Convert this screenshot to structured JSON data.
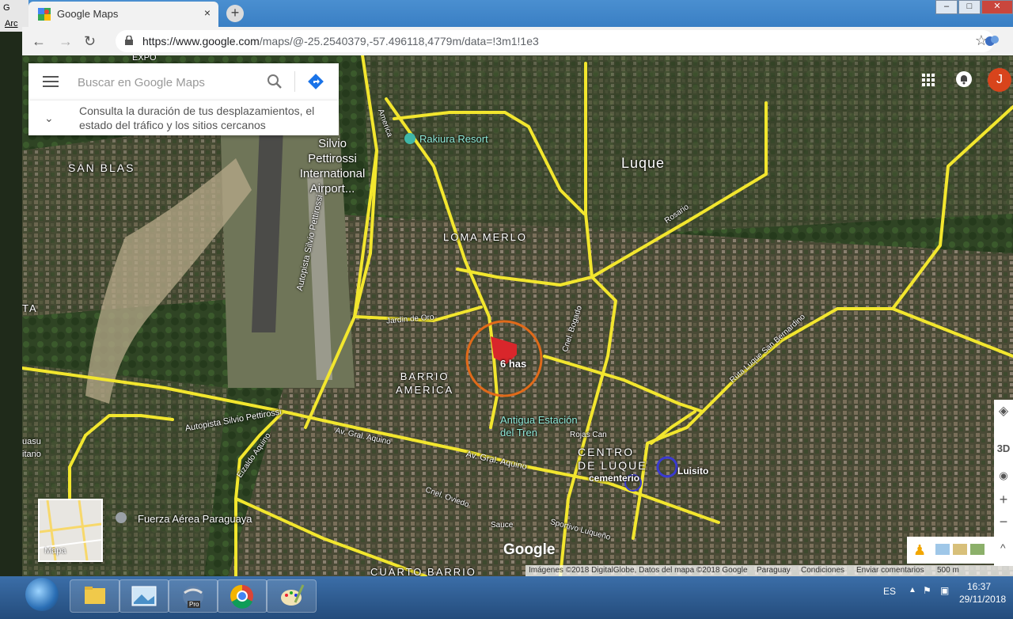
{
  "browser": {
    "tab_title": "Google Maps",
    "tab_close": "×",
    "new_tab": "+",
    "url_domain": "https://www.google.com",
    "url_path": "/maps/@-25.2540379,-57.496118,4779m/data=!3m1!1e3",
    "left_menu_fragment": "Arc",
    "left_title_fragment": "G"
  },
  "search": {
    "placeholder": "Buscar en Google Maps",
    "hint": "Consulta la duración de tus desplazamientos, el estado del tráfico y los sitios cercanos"
  },
  "account": {
    "avatar_letter": "J"
  },
  "map": {
    "labels": {
      "expo": "EXPO",
      "san_blas": "SAN BLAS",
      "airport": "Silvio\nPettirossi\nInternational\nAirport...",
      "rakiura": "Rakiura Resort",
      "luque": "Luque",
      "loma_merlo": "LOMA MERLO",
      "rosario": "Rosario",
      "america_road": "America",
      "cnel_bogado": "Cnel. Bogado",
      "jardin_de_oro": "Jardin de Oro",
      "autopista_vertical": "Autopista Silvio Pettirossi",
      "barrio_america": "BARRIO\nAMERICA",
      "six_has": "6 has",
      "ruta_luque": "Ruta Luque San Bernardino",
      "antigua_estacion": "Antigua Estación\ndel Tren",
      "autopista_horizontal": "Autopista Silvio Pettirossi",
      "gral_aquino": "Av. Gral. Aquino",
      "gral_aquino_2": "Av. Gral. Aquino",
      "rojas_cane": "Rojas Can",
      "centro_luque": "CENTRO\nDE LUQUE",
      "cementerio": "cementerio",
      "luisito": "Luisito",
      "cnel_oviedo": "Cnel. Oviedo",
      "fuerza_aerea": "Fuerza Aérea Paraguaya",
      "eizaldo": "Eizaldo Aquino",
      "sauce": "Sauce",
      "sportivo": "Sportivo Luqueño",
      "cuarto_barrio": "CUARTO BARRIO",
      "ta": "TA",
      "guasu": "uasu\nitano",
      "rosa": "Rosa",
      "luque_edge": "Luque"
    },
    "minimap_label": "Mapa",
    "google_logo": "Google",
    "footer": {
      "imagery": "Imágenes ©2018 DigitalGlobe, Datos del mapa ©2018 Google",
      "country": "Paraguay",
      "terms": "Condiciones",
      "feedback": "Enviar comentarios",
      "scale": "500 m"
    },
    "controls": {
      "tilt": "3D",
      "zoom_in": "+",
      "zoom_out": "−"
    }
  },
  "taskbar": {
    "lang": "ES",
    "time": "16:37",
    "date": "29/11/2018",
    "earth_badge": "Pro"
  },
  "colors": {
    "road_highlight": "#f2e62e",
    "circle_orange": "#e06a1a",
    "parcel_red": "#d9262b",
    "circle_blue": "#3a3ad0",
    "avatar": "#d8441c"
  }
}
